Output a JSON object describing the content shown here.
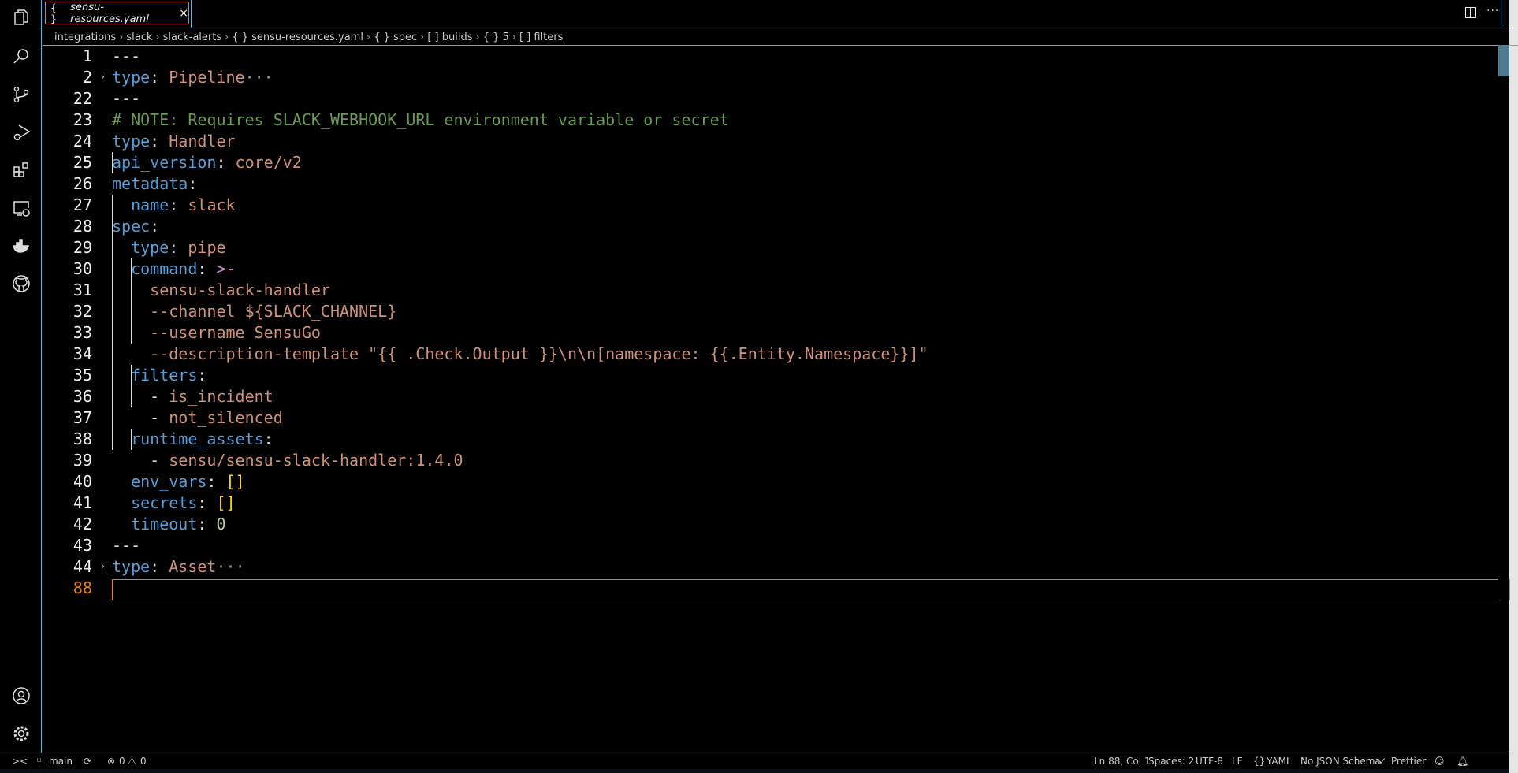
{
  "tab": {
    "icon": "{ }",
    "title": "sensu-resources.yaml",
    "close": "×"
  },
  "breadcrumbs": [
    "integrations",
    "slack",
    "slack-alerts",
    "{ } sensu-resources.yaml",
    "{ } spec",
    "[ ] builds",
    "{ } 5",
    "[ ] filters"
  ],
  "editor": {
    "lines": [
      {
        "n": "1",
        "tokens": [
          [
            "d",
            "---"
          ]
        ]
      },
      {
        "n": "2",
        "fold": "›",
        "tokens": [
          [
            "k",
            "type"
          ],
          [
            "p",
            ": "
          ],
          [
            "s",
            "Pipeline"
          ],
          [
            "el",
            "···"
          ]
        ]
      },
      {
        "n": "22",
        "tokens": [
          [
            "d",
            "---"
          ]
        ]
      },
      {
        "n": "23",
        "tokens": [
          [
            "c",
            "# NOTE: Requires SLACK_WEBHOOK_URL environment variable or secret"
          ]
        ]
      },
      {
        "n": "24",
        "tokens": [
          [
            "k",
            "type"
          ],
          [
            "p",
            ": "
          ],
          [
            "s",
            "Handler"
          ]
        ]
      },
      {
        "n": "25",
        "tokens": [
          [
            "k",
            "api_version"
          ],
          [
            "p",
            ": "
          ],
          [
            "s",
            "core/v2"
          ]
        ]
      },
      {
        "n": "26",
        "tokens": [
          [
            "k",
            "metadata"
          ],
          [
            "p",
            ":"
          ]
        ]
      },
      {
        "n": "27",
        "tokens": [
          [
            "p",
            "  "
          ],
          [
            "k",
            "name"
          ],
          [
            "p",
            ": "
          ],
          [
            "s",
            "slack"
          ]
        ]
      },
      {
        "n": "28",
        "tokens": [
          [
            "k",
            "spec"
          ],
          [
            "p",
            ":"
          ]
        ]
      },
      {
        "n": "29",
        "tokens": [
          [
            "p",
            "  "
          ],
          [
            "k",
            "type"
          ],
          [
            "p",
            ": "
          ],
          [
            "s",
            "pipe"
          ]
        ]
      },
      {
        "n": "30",
        "tokens": [
          [
            "p",
            "  "
          ],
          [
            "k",
            "command"
          ],
          [
            "p",
            ": "
          ],
          [
            "op",
            ">-"
          ]
        ]
      },
      {
        "n": "31",
        "tokens": [
          [
            "s",
            "    sensu-slack-handler"
          ]
        ]
      },
      {
        "n": "32",
        "tokens": [
          [
            "s",
            "    --channel ${SLACK_CHANNEL}"
          ]
        ]
      },
      {
        "n": "33",
        "tokens": [
          [
            "s",
            "    --username SensuGo"
          ]
        ]
      },
      {
        "n": "34",
        "tokens": [
          [
            "s",
            "    --description-template \"{{ .Check.Output }}\\n\\n[namespace: {{.Entity.Namespace}}]\""
          ]
        ]
      },
      {
        "n": "35",
        "tokens": [
          [
            "p",
            "  "
          ],
          [
            "k",
            "filters"
          ],
          [
            "p",
            ":"
          ]
        ]
      },
      {
        "n": "36",
        "tokens": [
          [
            "p",
            "    - "
          ],
          [
            "s",
            "is_incident"
          ]
        ]
      },
      {
        "n": "37",
        "tokens": [
          [
            "p",
            "    - "
          ],
          [
            "s",
            "not_silenced"
          ]
        ]
      },
      {
        "n": "38",
        "tokens": [
          [
            "p",
            "  "
          ],
          [
            "k",
            "runtime_assets"
          ],
          [
            "p",
            ":"
          ]
        ]
      },
      {
        "n": "39",
        "tokens": [
          [
            "p",
            "    - "
          ],
          [
            "s",
            "sensu/sensu-slack-handler:1.4.0"
          ]
        ]
      },
      {
        "n": "40",
        "tokens": [
          [
            "p",
            "  "
          ],
          [
            "k",
            "env_vars"
          ],
          [
            "p",
            ": "
          ],
          [
            "br",
            "[]"
          ]
        ]
      },
      {
        "n": "41",
        "tokens": [
          [
            "p",
            "  "
          ],
          [
            "k",
            "secrets"
          ],
          [
            "p",
            ": "
          ],
          [
            "br",
            "[]"
          ]
        ]
      },
      {
        "n": "42",
        "tokens": [
          [
            "p",
            "  "
          ],
          [
            "k",
            "timeout"
          ],
          [
            "p",
            ": "
          ],
          [
            "n",
            "0"
          ]
        ]
      },
      {
        "n": "43",
        "tokens": [
          [
            "d",
            "---"
          ]
        ]
      },
      {
        "n": "44",
        "fold": "›",
        "tokens": [
          [
            "k",
            "type"
          ],
          [
            "p",
            ": "
          ],
          [
            "s",
            "Asset"
          ],
          [
            "el",
            "···"
          ]
        ]
      },
      {
        "n": "88",
        "current": true,
        "tokens": []
      }
    ]
  },
  "status": {
    "remote": "><",
    "branch": "main",
    "sync": "⟳",
    "errors": "0",
    "warnings": "0",
    "position": "Ln 88, Col 1",
    "spaces": "Spaces: 2",
    "encoding": "UTF-8",
    "eol": "LF",
    "language": "YAML",
    "schema": "No JSON Schema",
    "formatter": "Prettier"
  },
  "colors": {
    "accent": "#5ab4d6",
    "active": "#e8801a"
  }
}
